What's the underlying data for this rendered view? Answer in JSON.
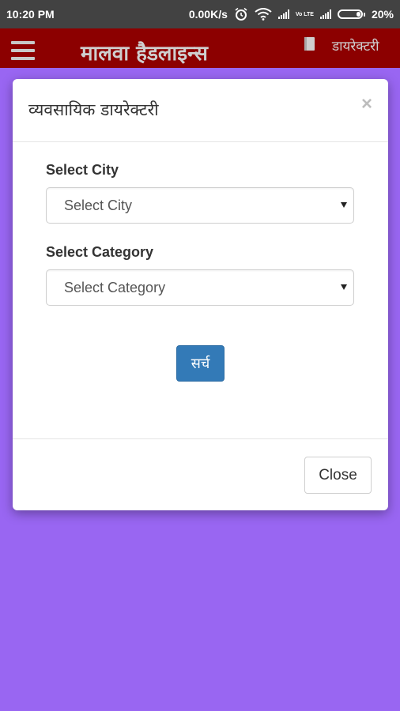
{
  "status_bar": {
    "time": "10:20 PM",
    "network_speed": "0.00K/s",
    "volte": "Vo LTE",
    "battery": "20%",
    "battery_level": 0.2
  },
  "app_bar": {
    "title": "मालवा हैडलाइन्स",
    "directory_link": "डायरेक्टरी",
    "menu_icon": "hamburger-icon",
    "book_icon": "book-icon"
  },
  "modal": {
    "title": "व्यवसायिक डायरेक्टरी",
    "close_x": "×",
    "city_label": "Select City",
    "city_select_value": "Select City",
    "category_label": "Select Category",
    "category_select_value": "Select Category",
    "search_button": "सर्च",
    "close_button": "Close"
  },
  "colors": {
    "status_bar": "#424242",
    "app_bar": "#8c0000",
    "background": "#9966f2",
    "primary_button": "#337ab7"
  }
}
